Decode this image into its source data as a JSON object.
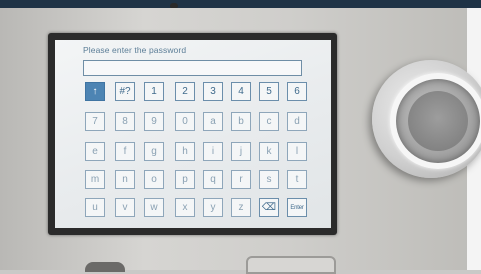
{
  "screen": {
    "prompt": "Please enter the password",
    "password_value": "",
    "keys": [
      {
        "label": "↑",
        "name": "key-shift",
        "selected": true
      },
      {
        "label": "#?",
        "name": "key-symbols"
      },
      {
        "label": "1"
      },
      {
        "label": "2"
      },
      {
        "label": "3"
      },
      {
        "label": "4"
      },
      {
        "label": "5"
      },
      {
        "label": "6"
      },
      {
        "label": "7"
      },
      {
        "label": "8"
      },
      {
        "label": "9"
      },
      {
        "label": "0"
      },
      {
        "label": "a"
      },
      {
        "label": "b"
      },
      {
        "label": "c"
      },
      {
        "label": "d"
      },
      {
        "label": "e"
      },
      {
        "label": "f"
      },
      {
        "label": "g"
      },
      {
        "label": "h"
      },
      {
        "label": "i"
      },
      {
        "label": "j"
      },
      {
        "label": "k"
      },
      {
        "label": "l"
      },
      {
        "label": "m"
      },
      {
        "label": "n"
      },
      {
        "label": "o"
      },
      {
        "label": "p"
      },
      {
        "label": "q"
      },
      {
        "label": "r"
      },
      {
        "label": "s"
      },
      {
        "label": "t"
      },
      {
        "label": "u"
      },
      {
        "label": "v"
      },
      {
        "label": "w"
      },
      {
        "label": "x"
      },
      {
        "label": "y"
      },
      {
        "label": "z"
      },
      {
        "label": "⌫",
        "name": "key-backspace"
      },
      {
        "label": "Enter",
        "name": "key-enter"
      }
    ]
  },
  "colors": {
    "screen_text": "#5c7e97",
    "key_border": "#8ea6ba",
    "key_selected": "#4d84b3"
  }
}
